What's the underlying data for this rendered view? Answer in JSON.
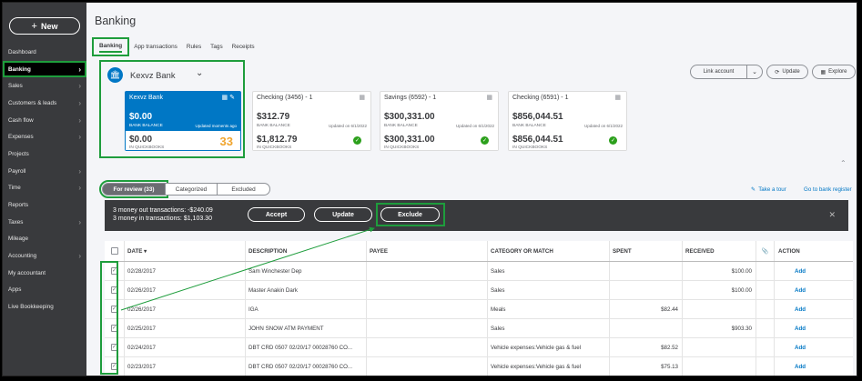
{
  "sidebar": {
    "new_label": "New",
    "items": [
      {
        "label": "Dashboard",
        "chev": false
      },
      {
        "label": "Banking",
        "chev": true,
        "active": true
      },
      {
        "label": "Sales",
        "chev": true
      },
      {
        "label": "Customers & leads",
        "chev": true
      },
      {
        "label": "Cash flow",
        "chev": true
      },
      {
        "label": "Expenses",
        "chev": true
      },
      {
        "label": "Projects",
        "chev": false
      },
      {
        "label": "Payroll",
        "chev": true
      },
      {
        "label": "Time",
        "chev": true
      },
      {
        "label": "Reports",
        "chev": false
      },
      {
        "label": "Taxes",
        "chev": true
      },
      {
        "label": "Mileage",
        "chev": false
      },
      {
        "label": "Accounting",
        "chev": true
      },
      {
        "label": "My accountant",
        "chev": false
      },
      {
        "label": "Apps",
        "chev": false
      },
      {
        "label": "Live Bookkeeping",
        "chev": false
      }
    ]
  },
  "header": {
    "title": "Banking",
    "tabs": [
      "Banking",
      "App transactions",
      "Rules",
      "Tags",
      "Receipts"
    ]
  },
  "account_selector": {
    "name": "Kexvz Bank"
  },
  "top_actions": {
    "link_account": "Link account",
    "update": "Update",
    "explore": "Explore"
  },
  "cards": [
    {
      "name": "Kexvz Bank",
      "bank_balance": "$0.00",
      "bank_balance_label": "BANK BALANCE",
      "updated": "Updated moments ago",
      "qb_balance": "$0.00",
      "qb_label": "IN QUICKBOOKS",
      "count": "33"
    },
    {
      "name": "Checking (3456) - 1",
      "bank_balance": "$312.79",
      "bank_balance_label": "BANK BALANCE",
      "updated": "Updated on 6/1/2022",
      "qb_balance": "$1,812.79",
      "qb_label": "IN QUICKBOOKS"
    },
    {
      "name": "Savings (6592) - 1",
      "bank_balance": "$300,331.00",
      "bank_balance_label": "BANK BALANCE",
      "updated": "Updated on 6/1/2022",
      "qb_balance": "$300,331.00",
      "qb_label": "IN QUICKBOOKS"
    },
    {
      "name": "Checking (6591) - 1",
      "bank_balance": "$856,044.51",
      "bank_balance_label": "BANK BALANCE",
      "updated": "Updated on 6/1/2022",
      "qb_balance": "$856,044.51",
      "qb_label": "IN QUICKBOOKS"
    }
  ],
  "review_tabs": {
    "for_review": "For review (33)",
    "categorized": "Categorized",
    "excluded": "Excluded"
  },
  "links": {
    "take_tour": "Take a tour",
    "go_register": "Go to bank register"
  },
  "batch": {
    "line1": "3 money out transactions: -$240.09",
    "line2": "3 money in transactions: $1,103.30",
    "accept": "Accept",
    "update": "Update",
    "exclude": "Exclude"
  },
  "table": {
    "headers": {
      "date": "DATE",
      "description": "DESCRIPTION",
      "payee": "PAYEE",
      "category": "CATEGORY OR MATCH",
      "spent": "SPENT",
      "received": "RECEIVED",
      "action": "ACTION"
    },
    "rows": [
      {
        "date": "02/28/2017",
        "description": "Sam Winchester Dep",
        "payee": "",
        "category": "Sales",
        "spent": "",
        "received": "$100.00",
        "action": "Add"
      },
      {
        "date": "02/26/2017",
        "description": "Master Anakin Dark",
        "payee": "",
        "category": "Sales",
        "spent": "",
        "received": "$100.00",
        "action": "Add"
      },
      {
        "date": "02/26/2017",
        "description": "IGA",
        "payee": "",
        "category": "Meals",
        "spent": "$82.44",
        "received": "",
        "action": "Add"
      },
      {
        "date": "02/25/2017",
        "description": "JOHN SNOW ATM PAYMENT",
        "payee": "",
        "category": "Sales",
        "spent": "",
        "received": "$903.30",
        "action": "Add"
      },
      {
        "date": "02/24/2017",
        "description": "DBT CRD 0507 02/20/17 00028760 CO...",
        "payee": "",
        "category": "Vehicle expenses:Vehicle gas & fuel",
        "spent": "$82.52",
        "received": "",
        "action": "Add"
      },
      {
        "date": "02/23/2017",
        "description": "DBT CRD 0507 02/20/17 00028760 CO...",
        "payee": "",
        "category": "Vehicle expenses:Vehicle gas & fuel",
        "spent": "$75.13",
        "received": "",
        "action": "Add"
      }
    ]
  }
}
